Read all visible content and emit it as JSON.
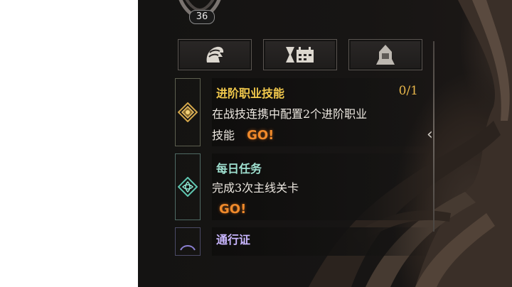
{
  "player": {
    "level": "36"
  },
  "tabs": [
    {
      "icon": "dragon-helm-icon"
    },
    {
      "icon": "calendar-hourglass-icon"
    },
    {
      "icon": "hooded-figure-icon"
    }
  ],
  "tasks": [
    {
      "title": "进阶职业技能",
      "title_color": "#f2c94c",
      "progress": "0/1",
      "desc_line1": "在战技连携中配置2个进阶职业",
      "desc_line2": "技能",
      "go": "GO!"
    },
    {
      "title": "每日任务",
      "title_color": "#9fe0d0",
      "desc_line1": "完成3次主线关卡",
      "go": "GO!"
    },
    {
      "title": "通行证",
      "title_color": "#c9b6ff"
    }
  ],
  "colors": {
    "go": "#f08a2b",
    "progress": "#e8b64a"
  }
}
